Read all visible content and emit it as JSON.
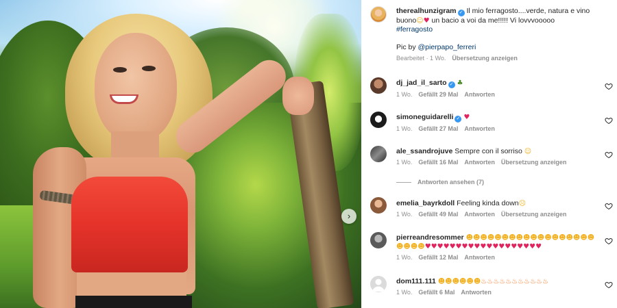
{
  "post": {
    "author": "therealhunzigram",
    "caption": "Il mio ferragosto....verde, natura e vino buono",
    "caption_rest": " un bacio a voi da me!!!!! Vi lovvvooooo",
    "hashtag": "#ferragosto",
    "credit_prefix": "Pic by ",
    "credit_mention": "@pierpapo_ferreri",
    "edited": "Bearbeitet · 1 Wo.",
    "translate": "Übersetzung anzeigen"
  },
  "comments": [
    {
      "user": "dj_jad_il_sarto",
      "verified": true,
      "text": "",
      "age": "1 Wo.",
      "likes": "Gefällt 29 Mal",
      "reply": "Antworten",
      "translate": ""
    },
    {
      "user": "simoneguidarelli",
      "verified": true,
      "text": "",
      "age": "1 Wo.",
      "likes": "Gefällt 27 Mal",
      "reply": "Antworten",
      "translate": ""
    },
    {
      "user": "ale_ssandrojuve",
      "verified": false,
      "text": "Sempre con il sorriso",
      "age": "1 Wo.",
      "likes": "Gefällt 16 Mal",
      "reply": "Antworten",
      "translate": "Übersetzung anzeigen"
    },
    {
      "user": "emelia_bayrkdoll",
      "verified": false,
      "text": "Feeling kinda down",
      "age": "1 Wo.",
      "likes": "Gefällt 49 Mal",
      "reply": "Antworten",
      "translate": "Übersetzung anzeigen"
    },
    {
      "user": "pierreandresommer",
      "verified": false,
      "text": "",
      "age": "1 Wo.",
      "likes": "Gefällt 12 Mal",
      "reply": "Antworten",
      "translate": ""
    },
    {
      "user": "dom111.111",
      "verified": false,
      "text": "",
      "age": "1 Wo.",
      "likes": "Gefällt 6 Mal",
      "reply": "Antworten",
      "translate": ""
    }
  ],
  "view_replies": "Antworten ansehen (7)",
  "icons": {
    "verified": "verified-badge-icon",
    "like": "heart-outline-icon",
    "carousel": "chevron-right-icon"
  },
  "colors": {
    "link": "#00376b",
    "verified": "#3897f0",
    "meta": "#8e8e8e",
    "heart_emoji": "#e0245e"
  }
}
